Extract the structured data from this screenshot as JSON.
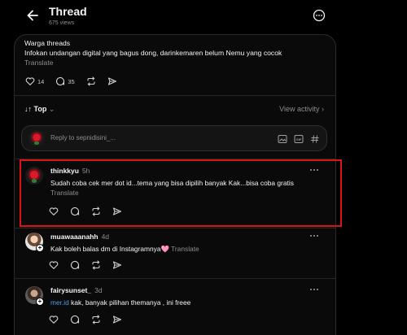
{
  "header": {
    "title": "Thread",
    "views": "675 views"
  },
  "post": {
    "author": "Warga threads",
    "text": "Infokan undangan digital yang bagus dong, darinkemaren belum Nemu yang cocok",
    "translate": "Translate",
    "likes": "14",
    "replies": "35"
  },
  "sort": {
    "label": "Top",
    "view_activity": "View activity"
  },
  "reply_box": {
    "placeholder": "Reply to sepnidisini_..."
  },
  "comments": [
    {
      "user": "thinkkyu",
      "time": "5h",
      "text": "Sudah coba cek mer dot id...tema yang bisa dipilih banyak Kak...bisa coba gratis",
      "translate": "Translate"
    },
    {
      "user": "muawaaanahh",
      "time": "4d",
      "text": "Kak boleh balas dm di Instagramnya🩷",
      "translate": "Translate"
    },
    {
      "user": "fairysunset_",
      "time": "3d",
      "link": "mer.id",
      "text": " kak, banyak pilihan themanya , ini freee"
    }
  ],
  "colors": {
    "background": "#000000",
    "card": "#0a0a0a",
    "highlight": "#d81515",
    "link": "#4a9fe8",
    "muted": "#8a8d91"
  }
}
